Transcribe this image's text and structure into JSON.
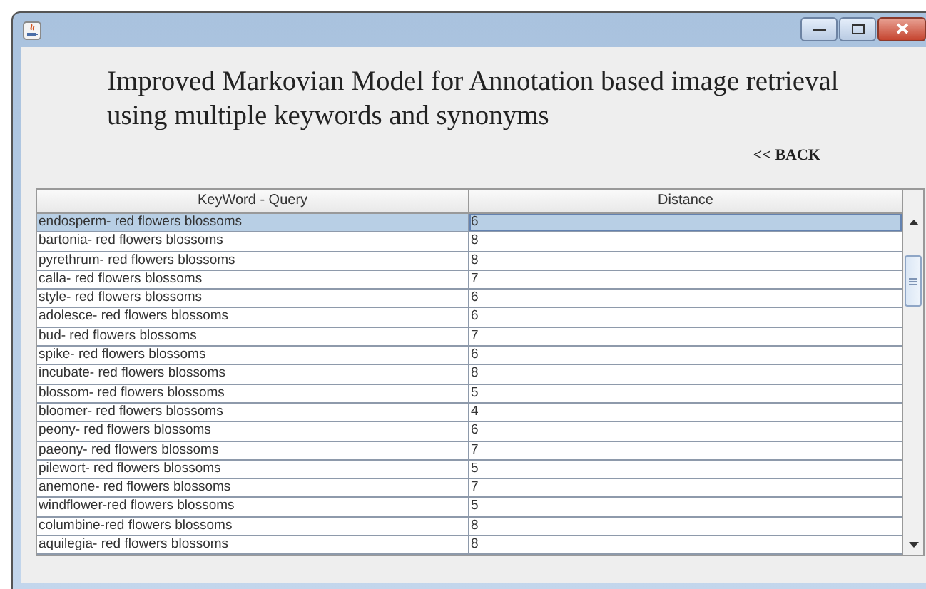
{
  "heading": "Improved Markovian Model for Annotation based image retrieval using multiple keywords and synonyms",
  "back_link": "<< BACK",
  "table": {
    "columns": [
      "KeyWord - Query",
      "Distance"
    ],
    "rows": [
      {
        "keyword": "endosperm- red flowers blossoms",
        "distance": "6",
        "selected": true
      },
      {
        "keyword": "bartonia- red flowers blossoms",
        "distance": "8",
        "selected": false
      },
      {
        "keyword": "pyrethrum- red flowers blossoms",
        "distance": "8",
        "selected": false
      },
      {
        "keyword": "calla- red flowers blossoms",
        "distance": "7",
        "selected": false
      },
      {
        "keyword": "style- red flowers blossoms",
        "distance": "6",
        "selected": false
      },
      {
        "keyword": "adolesce- red flowers blossoms",
        "distance": "6",
        "selected": false
      },
      {
        "keyword": "bud- red flowers blossoms",
        "distance": "7",
        "selected": false
      },
      {
        "keyword": "spike- red flowers blossoms",
        "distance": "6",
        "selected": false
      },
      {
        "keyword": "incubate- red flowers blossoms",
        "distance": "8",
        "selected": false
      },
      {
        "keyword": "blossom- red flowers blossoms",
        "distance": "5",
        "selected": false
      },
      {
        "keyword": "bloomer- red flowers blossoms",
        "distance": "4",
        "selected": false
      },
      {
        "keyword": "peony- red flowers blossoms",
        "distance": "6",
        "selected": false
      },
      {
        "keyword": "paeony- red flowers blossoms",
        "distance": "7",
        "selected": false
      },
      {
        "keyword": "pilewort- red flowers blossoms",
        "distance": "5",
        "selected": false
      },
      {
        "keyword": "anemone- red flowers blossoms",
        "distance": "7",
        "selected": false
      },
      {
        "keyword": "windflower-red flowers blossoms",
        "distance": "5",
        "selected": false
      },
      {
        "keyword": "columbine-red flowers blossoms",
        "distance": "8",
        "selected": false
      },
      {
        "keyword": "aquilegia- red flowers blossoms",
        "distance": "8",
        "selected": false
      }
    ]
  }
}
